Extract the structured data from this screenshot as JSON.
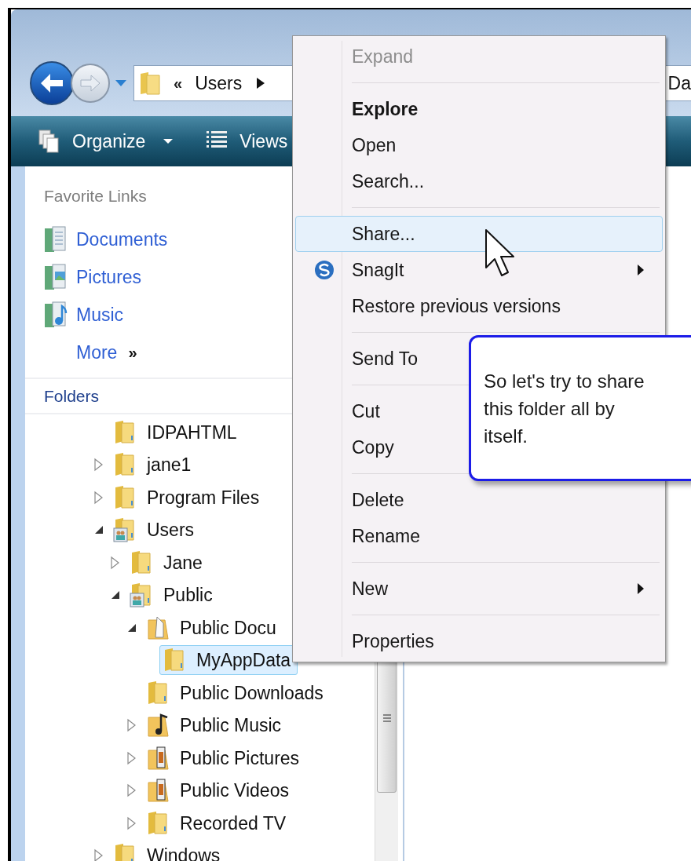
{
  "address_bar": {
    "overflow": "«",
    "crumbs": [
      "Users"
    ],
    "cut_text": "Da"
  },
  "toolbar": {
    "items": [
      {
        "label": "Organize",
        "kind": "organize",
        "dropdown": true
      },
      {
        "label": "Views",
        "kind": "views",
        "dropdown": false
      }
    ]
  },
  "favorite_links": {
    "title": "Favorite Links",
    "items": [
      {
        "label": "Documents",
        "kind": "documents"
      },
      {
        "label": "Pictures",
        "kind": "pictures"
      },
      {
        "label": "Music",
        "kind": "music"
      }
    ],
    "more": {
      "label": "More",
      "chevron": "»"
    }
  },
  "folders": {
    "title": "Folders",
    "tree": [
      {
        "label": "IDPAHTML",
        "kind": "folder",
        "has_children": false,
        "selected": false
      },
      {
        "label": "jane1",
        "kind": "folder",
        "has_children": true,
        "expanded": false,
        "selected": false
      },
      {
        "label": "Program Files",
        "kind": "folder",
        "has_children": true,
        "expanded": false,
        "selected": false
      },
      {
        "label": "Users",
        "kind": "people",
        "has_children": true,
        "expanded": true,
        "selected": false,
        "children": [
          {
            "label": "Jane",
            "kind": "folder",
            "has_children": true,
            "expanded": false,
            "selected": false
          },
          {
            "label": "Public",
            "kind": "people",
            "has_children": true,
            "expanded": true,
            "selected": false,
            "children": [
              {
                "label": "Public Docu",
                "kind": "document",
                "has_children": true,
                "expanded": true,
                "selected": false,
                "children": [
                  {
                    "label": "MyAppData",
                    "kind": "folder",
                    "has_children": false,
                    "selected": true
                  }
                ]
              },
              {
                "label": "Public Downloads",
                "kind": "folder",
                "has_children": false,
                "selected": false
              },
              {
                "label": "Public Music",
                "kind": "music",
                "has_children": true,
                "expanded": false,
                "selected": false
              },
              {
                "label": "Public Pictures",
                "kind": "media",
                "has_children": true,
                "expanded": false,
                "selected": false
              },
              {
                "label": "Public Videos",
                "kind": "media",
                "has_children": true,
                "expanded": false,
                "selected": false
              },
              {
                "label": "Recorded TV",
                "kind": "folder",
                "has_children": true,
                "expanded": false,
                "selected": false
              }
            ]
          }
        ]
      },
      {
        "label": "Windows",
        "kind": "folder",
        "has_children": true,
        "expanded": false,
        "selected": false
      }
    ]
  },
  "context_menu": {
    "groups": [
      [
        {
          "label": "Expand",
          "disabled": true,
          "default": false,
          "selected": false,
          "submenu": false,
          "icon": false
        }
      ],
      [
        {
          "label": "Explore",
          "disabled": false,
          "default": true,
          "selected": false,
          "submenu": false,
          "icon": false
        },
        {
          "label": "Open",
          "disabled": false,
          "default": false,
          "selected": false,
          "submenu": false,
          "icon": false
        },
        {
          "label": "Search...",
          "disabled": false,
          "default": false,
          "selected": false,
          "submenu": false,
          "icon": false
        }
      ],
      [
        {
          "label": "Share...",
          "disabled": false,
          "default": false,
          "selected": true,
          "submenu": false,
          "icon": false
        },
        {
          "label": "SnagIt",
          "disabled": false,
          "default": false,
          "selected": false,
          "submenu": true,
          "icon": true
        },
        {
          "label": "Restore previous versions",
          "disabled": false,
          "default": false,
          "selected": false,
          "submenu": false,
          "icon": false
        }
      ],
      [
        {
          "label": "Send To",
          "disabled": false,
          "default": false,
          "selected": false,
          "icon": false
        }
      ],
      [
        {
          "label": "Cut",
          "disabled": false,
          "default": false,
          "selected": false,
          "icon": false
        },
        {
          "label": "Copy",
          "disabled": false,
          "default": false,
          "selected": false,
          "icon": false
        }
      ],
      [
        {
          "label": "Delete",
          "disabled": false,
          "default": false,
          "selected": false,
          "submenu": false,
          "icon": false
        },
        {
          "label": "Rename",
          "disabled": false,
          "default": false,
          "selected": false,
          "submenu": false,
          "icon": false
        }
      ],
      [
        {
          "label": "New",
          "disabled": false,
          "default": false,
          "selected": false,
          "submenu": true,
          "icon": false
        }
      ],
      [
        {
          "label": "Properties",
          "disabled": false,
          "default": false,
          "selected": false,
          "submenu": false,
          "icon": false
        }
      ]
    ]
  },
  "callout": {
    "text": "So let's try to share this folder all by itself."
  }
}
